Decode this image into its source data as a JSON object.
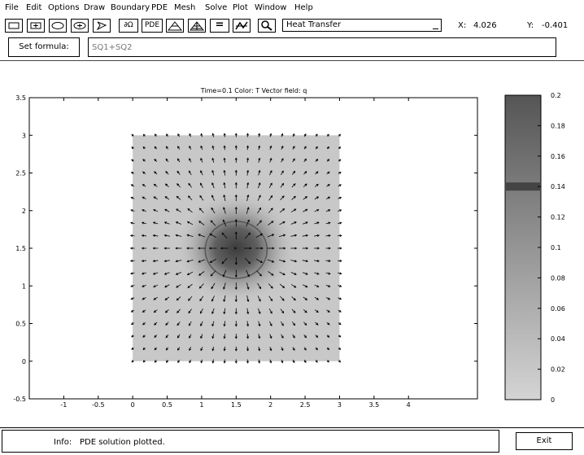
{
  "menu": [
    "File",
    "Edit",
    "Options",
    "Draw",
    "Boundary",
    "PDE",
    "Mesh",
    "Solve",
    "Plot",
    "Window",
    "Help"
  ],
  "toolbar": {
    "buttons": [
      "rectangle-icon",
      "centered-rectangle-icon",
      "ellipse-icon",
      "centered-ellipse-icon",
      "polygon-icon",
      "boundary-icon",
      "pde-icon",
      "mesh-icon",
      "refine-mesh-icon",
      "solve-icon",
      "plot-icon",
      "zoom-icon"
    ],
    "boundary_label": "∂Ω",
    "pde_label": "PDE",
    "solve_label": "="
  },
  "application_mode": "Heat Transfer",
  "coords": {
    "x_label": "X:",
    "x_value": "4.026",
    "y_label": "Y:",
    "y_value": "-0.401"
  },
  "formula": {
    "label": "Set formula:",
    "value": "SQ1+SQ2"
  },
  "plot": {
    "title": "Time=0.1   Color: T  Vector field: q",
    "xlim": [
      -1.5,
      5
    ],
    "ylim": [
      -0.5,
      3.5
    ],
    "xticks": [
      "-1",
      "-0.5",
      "0",
      "0.5",
      "1",
      "1.5",
      "2",
      "2.5",
      "3",
      "3.5",
      "4"
    ],
    "yticks": [
      "-0.5",
      "0",
      "0.5",
      "1",
      "1.5",
      "2",
      "2.5",
      "3",
      "3.5"
    ],
    "domain_square": {
      "x": [
        0,
        3
      ],
      "y": [
        0,
        3
      ]
    },
    "hot_spot_center": [
      1.5,
      1.5
    ],
    "colors": {
      "domain_fill": "#c8c8c8",
      "hot_spot": "#404040"
    }
  },
  "colorbar": {
    "ticks": [
      "0.2",
      "0.18",
      "0.16",
      "0.14",
      "0.12",
      "0.1",
      "0.08",
      "0.06",
      "0.04",
      "0.02",
      "0"
    ],
    "range": [
      0,
      0.2
    ],
    "highlight_value": 0.14,
    "colors": {
      "top": "#555555",
      "bottom": "#d4d4d4"
    }
  },
  "status": {
    "label": "Info:",
    "text": "PDE solution plotted."
  },
  "exit_label": "Exit"
}
